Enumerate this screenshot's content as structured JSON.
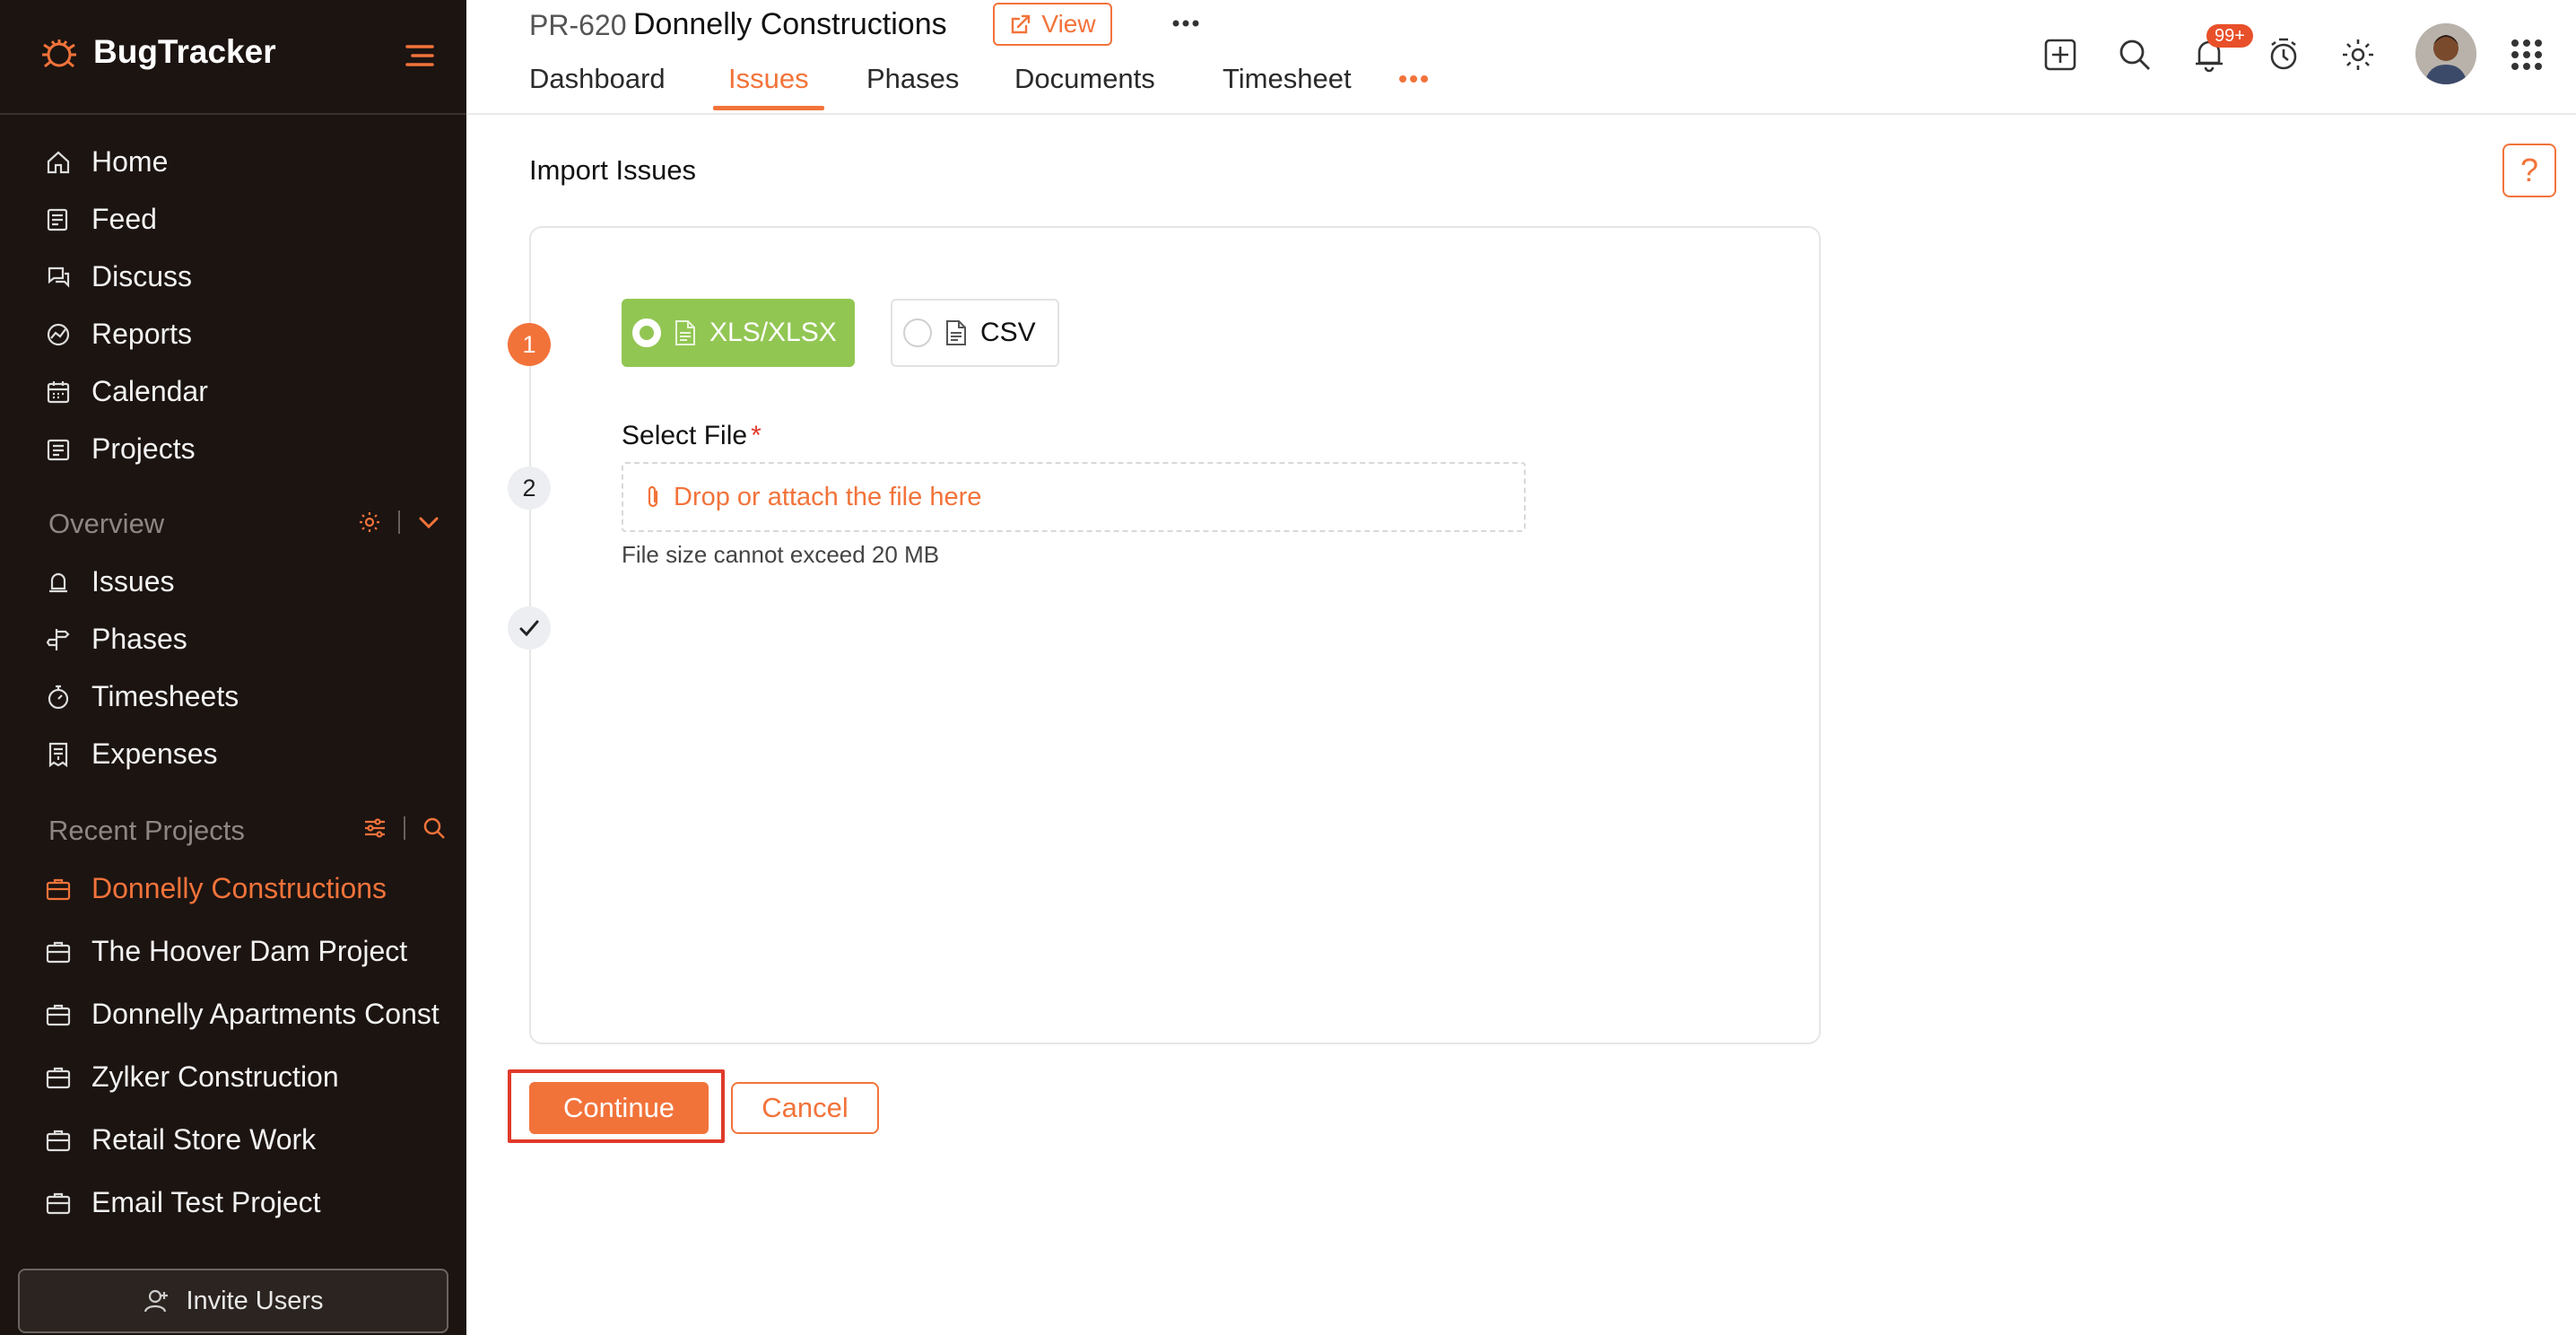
{
  "app": {
    "name": "BugTracker"
  },
  "colors": {
    "accent": "#f2733a",
    "sidebar_bg": "#1c1411",
    "success": "#92c653"
  },
  "sidebar": {
    "main_items": [
      {
        "label": "Home",
        "icon": "home-icon"
      },
      {
        "label": "Feed",
        "icon": "feed-icon"
      },
      {
        "label": "Discuss",
        "icon": "discuss-icon"
      },
      {
        "label": "Reports",
        "icon": "reports-icon"
      },
      {
        "label": "Calendar",
        "icon": "calendar-icon"
      },
      {
        "label": "Projects",
        "icon": "projects-icon"
      }
    ],
    "overview": {
      "label": "Overview",
      "items": [
        {
          "label": "Issues",
          "icon": "bell-icon"
        },
        {
          "label": "Phases",
          "icon": "signpost-icon"
        },
        {
          "label": "Timesheets",
          "icon": "stopwatch-icon"
        },
        {
          "label": "Expenses",
          "icon": "receipt-icon"
        }
      ]
    },
    "recent": {
      "label": "Recent Projects",
      "items": [
        {
          "label": "Donnelly Constructions",
          "active": true
        },
        {
          "label": "The Hoover Dam Project",
          "active": false
        },
        {
          "label": "Donnelly Apartments Construction",
          "active": false
        },
        {
          "label": "Zylker Construction",
          "active": false
        },
        {
          "label": "Retail Store Work",
          "active": false
        },
        {
          "label": "Email Test Project",
          "active": false
        }
      ]
    },
    "invite_label": "Invite Users"
  },
  "header": {
    "project_id": "PR-620",
    "project_name": "Donnelly Constructions",
    "view_label": "View",
    "tabs": [
      {
        "label": "Dashboard",
        "active": false
      },
      {
        "label": "Issues",
        "active": true
      },
      {
        "label": "Phases",
        "active": false
      },
      {
        "label": "Documents",
        "active": false
      },
      {
        "label": "Timesheet",
        "active": false
      }
    ],
    "notification_count": "99+"
  },
  "main": {
    "title": "Import Issues",
    "help_label": "?",
    "steps": [
      "1",
      "2"
    ],
    "formats": [
      {
        "label": "XLS/XLSX",
        "selected": true
      },
      {
        "label": "CSV",
        "selected": false
      }
    ],
    "file_label": "Select File",
    "required_mark": "*",
    "dropzone_text": "Drop or attach the file here",
    "size_hint": "File size cannot exceed 20 MB",
    "continue_label": "Continue",
    "cancel_label": "Cancel"
  }
}
